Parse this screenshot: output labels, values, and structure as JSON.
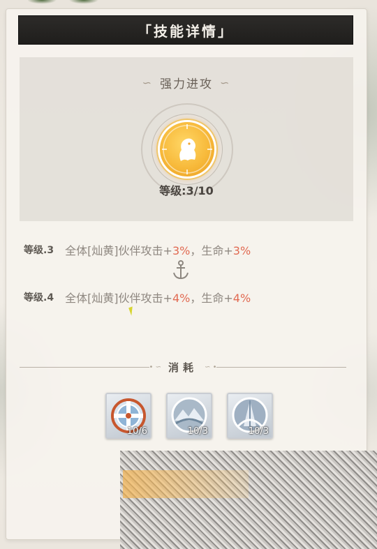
{
  "panel": {
    "title": "「技能详情」"
  },
  "skill": {
    "name": "强力进攻",
    "level_label": "等级:3/10",
    "level": 3,
    "max_level": 10,
    "icon": "orange-circle-hatchling-icon"
  },
  "effects": [
    {
      "level_label": "等级.3",
      "prefix": "全体[灿黄]伙伴攻击+",
      "attack_value": "3%",
      "mid": "，生命+",
      "hp_value": "3%"
    },
    {
      "level_label": "等级.4",
      "prefix": "全体[灿黄]伙伴攻击+",
      "attack_value": "4%",
      "mid": "，生命+",
      "hp_value": "4%"
    }
  ],
  "cost_section": {
    "label": "消耗"
  },
  "costs": [
    {
      "icon": "cross-shield-token-icon",
      "count": "10/6"
    },
    {
      "icon": "snowy-mountain-token-icon",
      "count": "10/3"
    },
    {
      "icon": "tower-spire-token-icon",
      "count": "10/3"
    }
  ],
  "colors": {
    "title_bar": "#1f1e1c",
    "highlight": "#e16a52",
    "skill_icon": "#f7b93a"
  }
}
